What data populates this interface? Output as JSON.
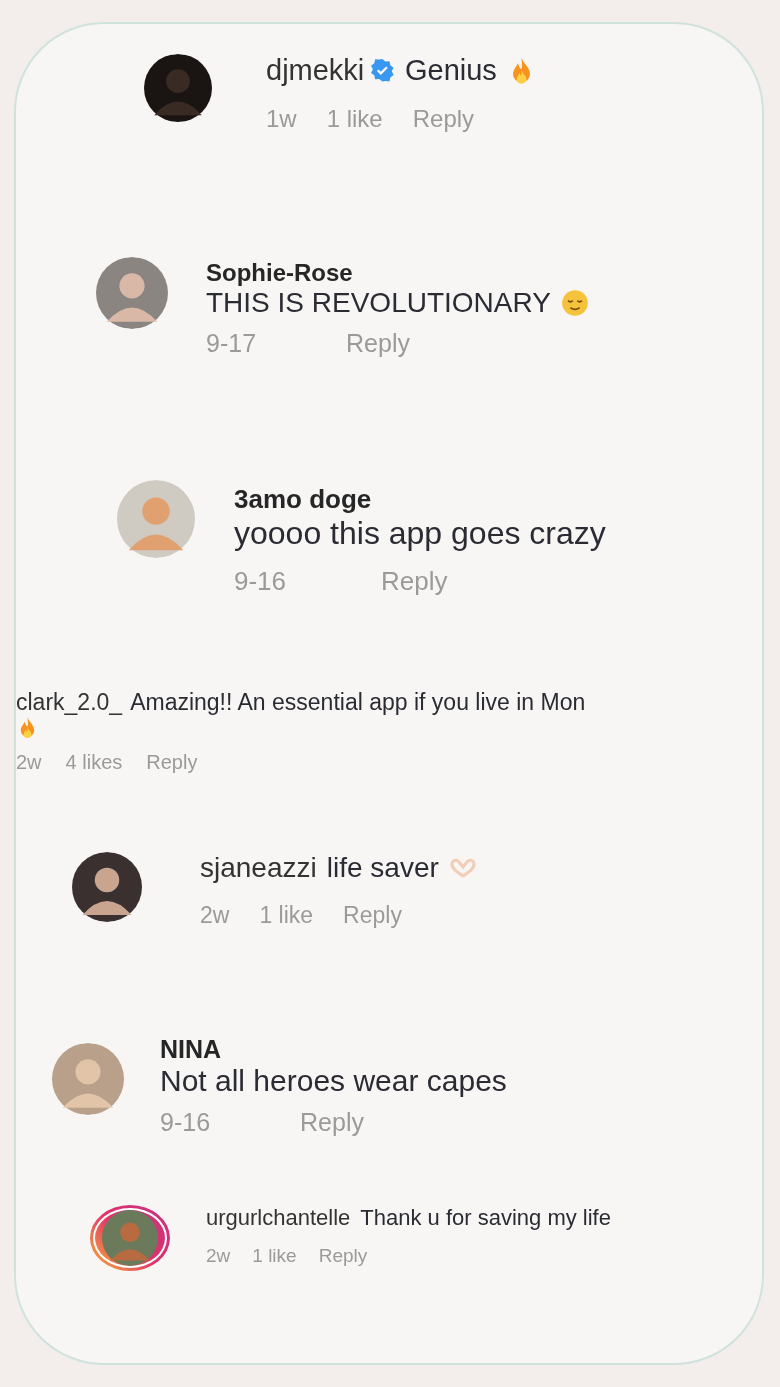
{
  "comments": [
    {
      "kind": "inline",
      "username": "djmekki",
      "verified": true,
      "text": "Genius",
      "trailing_icon": {
        "kind": "fire"
      },
      "story_ring": false,
      "time": "1w",
      "likes": "1 like",
      "reply": "Reply"
    },
    {
      "kind": "stacked",
      "username": "Sophie-Rose",
      "verified": false,
      "text": "THIS IS REVOLUTIONARY",
      "trailing_icon": {
        "kind": "relieved"
      },
      "story_ring": false,
      "time": "9-17",
      "reply": "Reply"
    },
    {
      "kind": "stacked",
      "username": "3amo doge",
      "verified": false,
      "text": "yoooo this app goes crazy",
      "story_ring": false,
      "time": "9-16",
      "reply": "Reply"
    },
    {
      "kind": "bare",
      "username": "clark_2.0_",
      "verified": false,
      "text": "Amazing!! An essential app if you live in Mon",
      "trailing_icon": {
        "kind": "fire"
      },
      "time": "2w",
      "likes": "4 likes",
      "reply": "Reply"
    },
    {
      "kind": "inline",
      "username": "sjaneazzi",
      "verified": false,
      "text": "life saver",
      "trailing_icon": {
        "kind": "heart-hands"
      },
      "story_ring": false,
      "time": "2w",
      "likes": "1 like",
      "reply": "Reply"
    },
    {
      "kind": "stacked",
      "username": "NINA",
      "verified": false,
      "text": "Not all heroes wear capes",
      "story_ring": false,
      "time": "9-16",
      "reply": "Reply"
    },
    {
      "kind": "inline",
      "username": "urgurlchantelle",
      "verified": false,
      "text": "Thank u for saving my life",
      "story_ring": true,
      "time": "2w",
      "likes": "1 like",
      "reply": "Reply"
    }
  ]
}
